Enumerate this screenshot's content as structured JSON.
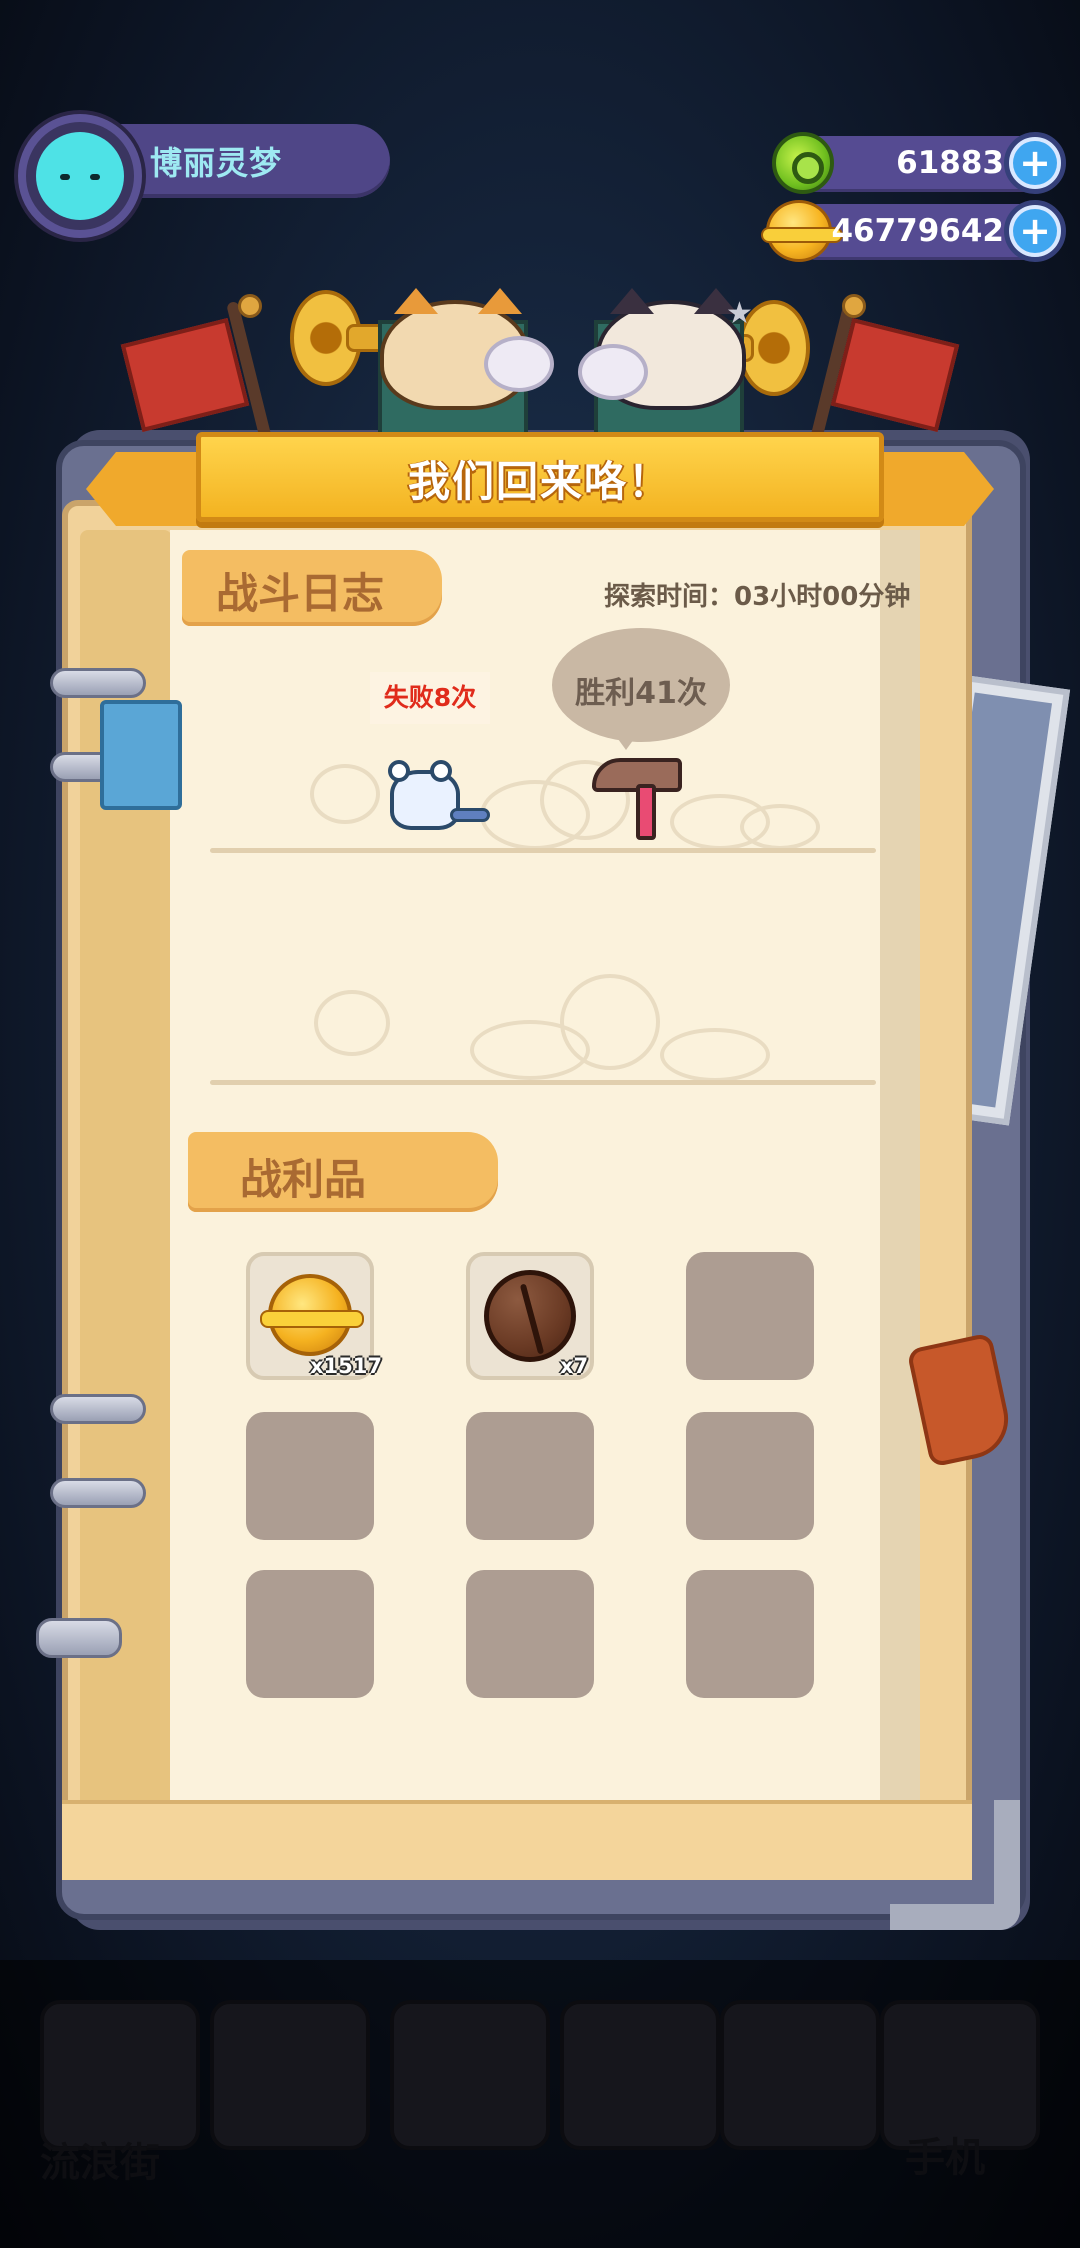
{
  "player": {
    "name": "博丽灵梦",
    "avatar_icon": "cat-avatar-icon"
  },
  "currencies": [
    {
      "name": "gem",
      "icon": "green-gem-icon",
      "value": "61883"
    },
    {
      "name": "coin",
      "icon": "gold-planet-coin-icon",
      "value": "46779642"
    }
  ],
  "dialog": {
    "title": "我们回来咯！",
    "battle_log": {
      "header": "战斗日志",
      "explore_time": "探索时间：03小时00分钟",
      "defeat_text": "失败8次",
      "victory_text": "胜利41次"
    },
    "loot": {
      "header": "战利品",
      "items": [
        {
          "icon": "gold-planet-coin-icon",
          "qty": "x1517"
        },
        {
          "icon": "brown-nut-icon",
          "qty": "x7"
        },
        {
          "icon": "empty-slot",
          "qty": ""
        },
        {
          "icon": "empty-slot",
          "qty": ""
        },
        {
          "icon": "empty-slot",
          "qty": ""
        },
        {
          "icon": "empty-slot",
          "qty": ""
        },
        {
          "icon": "empty-slot",
          "qty": ""
        },
        {
          "icon": "empty-slot",
          "qty": ""
        },
        {
          "icon": "empty-slot",
          "qty": ""
        }
      ]
    }
  },
  "background_nav": {
    "labels": [
      "流浪街",
      "手机"
    ]
  },
  "colors": {
    "banner": "#f3b321",
    "defeat_red": "#e02b1b",
    "hud_bar": "#554b92",
    "plus_blue": "#3fa6f0"
  }
}
